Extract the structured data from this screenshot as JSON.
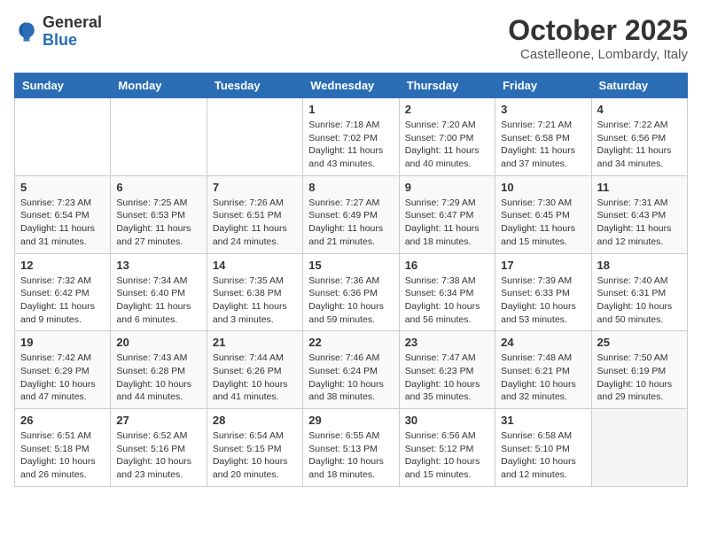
{
  "logo": {
    "general": "General",
    "blue": "Blue"
  },
  "header": {
    "month": "October 2025",
    "location": "Castelleone, Lombardy, Italy"
  },
  "days_of_week": [
    "Sunday",
    "Monday",
    "Tuesday",
    "Wednesday",
    "Thursday",
    "Friday",
    "Saturday"
  ],
  "weeks": [
    [
      {
        "day": "",
        "info": ""
      },
      {
        "day": "",
        "info": ""
      },
      {
        "day": "",
        "info": ""
      },
      {
        "day": "1",
        "info": "Sunrise: 7:18 AM\nSunset: 7:02 PM\nDaylight: 11 hours and 43 minutes."
      },
      {
        "day": "2",
        "info": "Sunrise: 7:20 AM\nSunset: 7:00 PM\nDaylight: 11 hours and 40 minutes."
      },
      {
        "day": "3",
        "info": "Sunrise: 7:21 AM\nSunset: 6:58 PM\nDaylight: 11 hours and 37 minutes."
      },
      {
        "day": "4",
        "info": "Sunrise: 7:22 AM\nSunset: 6:56 PM\nDaylight: 11 hours and 34 minutes."
      }
    ],
    [
      {
        "day": "5",
        "info": "Sunrise: 7:23 AM\nSunset: 6:54 PM\nDaylight: 11 hours and 31 minutes."
      },
      {
        "day": "6",
        "info": "Sunrise: 7:25 AM\nSunset: 6:53 PM\nDaylight: 11 hours and 27 minutes."
      },
      {
        "day": "7",
        "info": "Sunrise: 7:26 AM\nSunset: 6:51 PM\nDaylight: 11 hours and 24 minutes."
      },
      {
        "day": "8",
        "info": "Sunrise: 7:27 AM\nSunset: 6:49 PM\nDaylight: 11 hours and 21 minutes."
      },
      {
        "day": "9",
        "info": "Sunrise: 7:29 AM\nSunset: 6:47 PM\nDaylight: 11 hours and 18 minutes."
      },
      {
        "day": "10",
        "info": "Sunrise: 7:30 AM\nSunset: 6:45 PM\nDaylight: 11 hours and 15 minutes."
      },
      {
        "day": "11",
        "info": "Sunrise: 7:31 AM\nSunset: 6:43 PM\nDaylight: 11 hours and 12 minutes."
      }
    ],
    [
      {
        "day": "12",
        "info": "Sunrise: 7:32 AM\nSunset: 6:42 PM\nDaylight: 11 hours and 9 minutes."
      },
      {
        "day": "13",
        "info": "Sunrise: 7:34 AM\nSunset: 6:40 PM\nDaylight: 11 hours and 6 minutes."
      },
      {
        "day": "14",
        "info": "Sunrise: 7:35 AM\nSunset: 6:38 PM\nDaylight: 11 hours and 3 minutes."
      },
      {
        "day": "15",
        "info": "Sunrise: 7:36 AM\nSunset: 6:36 PM\nDaylight: 10 hours and 59 minutes."
      },
      {
        "day": "16",
        "info": "Sunrise: 7:38 AM\nSunset: 6:34 PM\nDaylight: 10 hours and 56 minutes."
      },
      {
        "day": "17",
        "info": "Sunrise: 7:39 AM\nSunset: 6:33 PM\nDaylight: 10 hours and 53 minutes."
      },
      {
        "day": "18",
        "info": "Sunrise: 7:40 AM\nSunset: 6:31 PM\nDaylight: 10 hours and 50 minutes."
      }
    ],
    [
      {
        "day": "19",
        "info": "Sunrise: 7:42 AM\nSunset: 6:29 PM\nDaylight: 10 hours and 47 minutes."
      },
      {
        "day": "20",
        "info": "Sunrise: 7:43 AM\nSunset: 6:28 PM\nDaylight: 10 hours and 44 minutes."
      },
      {
        "day": "21",
        "info": "Sunrise: 7:44 AM\nSunset: 6:26 PM\nDaylight: 10 hours and 41 minutes."
      },
      {
        "day": "22",
        "info": "Sunrise: 7:46 AM\nSunset: 6:24 PM\nDaylight: 10 hours and 38 minutes."
      },
      {
        "day": "23",
        "info": "Sunrise: 7:47 AM\nSunset: 6:23 PM\nDaylight: 10 hours and 35 minutes."
      },
      {
        "day": "24",
        "info": "Sunrise: 7:48 AM\nSunset: 6:21 PM\nDaylight: 10 hours and 32 minutes."
      },
      {
        "day": "25",
        "info": "Sunrise: 7:50 AM\nSunset: 6:19 PM\nDaylight: 10 hours and 29 minutes."
      }
    ],
    [
      {
        "day": "26",
        "info": "Sunrise: 6:51 AM\nSunset: 5:18 PM\nDaylight: 10 hours and 26 minutes."
      },
      {
        "day": "27",
        "info": "Sunrise: 6:52 AM\nSunset: 5:16 PM\nDaylight: 10 hours and 23 minutes."
      },
      {
        "day": "28",
        "info": "Sunrise: 6:54 AM\nSunset: 5:15 PM\nDaylight: 10 hours and 20 minutes."
      },
      {
        "day": "29",
        "info": "Sunrise: 6:55 AM\nSunset: 5:13 PM\nDaylight: 10 hours and 18 minutes."
      },
      {
        "day": "30",
        "info": "Sunrise: 6:56 AM\nSunset: 5:12 PM\nDaylight: 10 hours and 15 minutes."
      },
      {
        "day": "31",
        "info": "Sunrise: 6:58 AM\nSunset: 5:10 PM\nDaylight: 10 hours and 12 minutes."
      },
      {
        "day": "",
        "info": ""
      }
    ]
  ]
}
